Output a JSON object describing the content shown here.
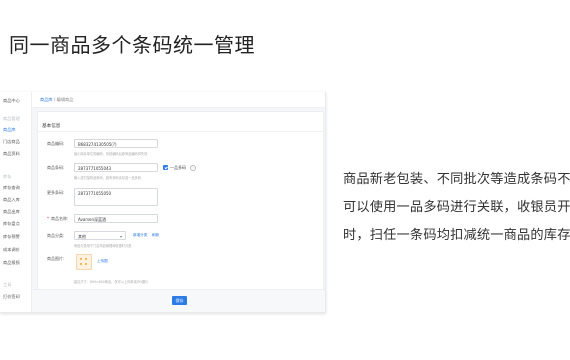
{
  "headline": "同一商品多个条码统一管理",
  "description": [
    "商品新老包装、不同批次等造成条码不",
    "可以使用一品多码进行关联，收银员开",
    "时，扫任一条码均扣减统一商品的库存"
  ],
  "sidebar": {
    "items": [
      {
        "label": "商品中心",
        "state": "normal"
      },
      {
        "label": "商品管理",
        "state": "muted"
      },
      {
        "label": "商品库",
        "state": "active"
      },
      {
        "label": "门店商品",
        "state": "normal"
      },
      {
        "label": "商品资料",
        "state": "normal"
      },
      {
        "label": "库存",
        "state": "muted"
      },
      {
        "label": "库存查询",
        "state": "normal"
      },
      {
        "label": "商品入库",
        "state": "normal"
      },
      {
        "label": "商品出库",
        "state": "normal"
      },
      {
        "label": "库存盘点",
        "state": "normal"
      },
      {
        "label": "库存预警",
        "state": "normal"
      },
      {
        "label": "成本调价",
        "state": "normal"
      },
      {
        "label": "商品报损",
        "state": "normal"
      },
      {
        "label": "工具",
        "state": "muted"
      },
      {
        "label": "打价签印",
        "state": "normal"
      }
    ]
  },
  "breadcrumb": {
    "parent": "商品库",
    "separator": " / ",
    "current": "编辑商品"
  },
  "form": {
    "section_title": "基本信息",
    "fields": {
      "code": {
        "label": "商品编码:",
        "value": "B683274130505(?)",
        "hint": "最小库存单位的编码，系统编码后原商品编码将失效"
      },
      "barcode": {
        "label": "商品条码:",
        "value": "2873771055043",
        "hint": "输入或扫描商品条码，若有多码请勾选一品多码"
      },
      "multi_code": {
        "label": "一品多码"
      },
      "alt_barcodes": {
        "label": "更多条码:",
        "value": "2873771055050"
      },
      "name": {
        "label": "商品名称:",
        "value": "Avarsen深蓝酒"
      },
      "category": {
        "label": "商品分类:",
        "value": "其他",
        "add_link": "新增分类",
        "refresh_link": "刷新",
        "hint": "商品分类用于门店商品管理和收银时分类"
      },
      "image": {
        "label": "商品图片:",
        "upload_link": "上传图",
        "hint": "建议尺寸：800×800像素，仅可以上传单张JPG图片"
      }
    }
  },
  "footer": {
    "save_label": "保存"
  }
}
